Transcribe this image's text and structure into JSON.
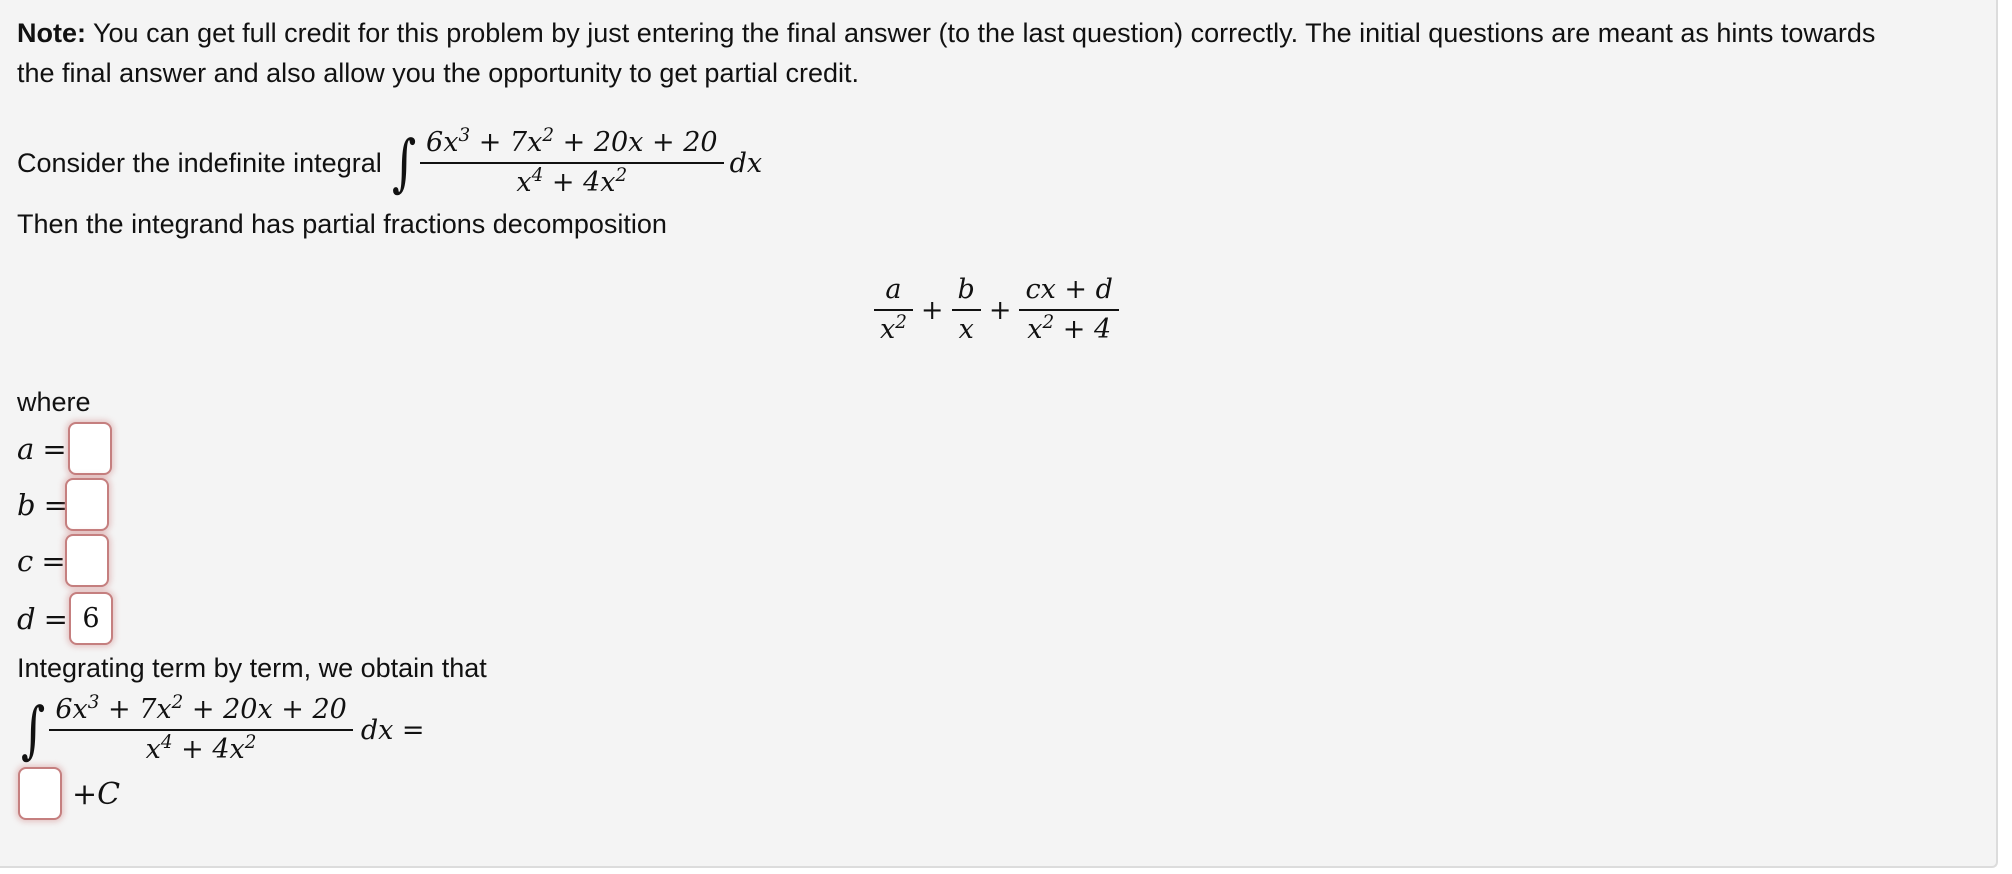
{
  "note": {
    "bold_label": "Note:",
    "line1": " You can get full credit for this problem by just entering the final answer (to the last question) correctly. The initial questions are meant as hints towards",
    "line2": "the final answer and also allow you the opportunity to get partial credit."
  },
  "intro": {
    "consider_text": "Consider the indefinite integral",
    "integral_symbol": "∫",
    "numerator": {
      "t1": "6x",
      "e1": "3",
      "p1": " + 7x",
      "e2": "2",
      "rest": " + 20x + 20"
    },
    "denominator": {
      "t1": "x",
      "e1": "4",
      "p1": " + 4x",
      "e2": "2"
    },
    "differential": "dx",
    "then_text": "Then the integrand has partial fractions decomposition"
  },
  "decomposition": {
    "term1": {
      "num": "a",
      "den": "x",
      "den_exp": "2"
    },
    "plus": "+",
    "term2": {
      "num": "b",
      "den": "x"
    },
    "term3": {
      "num": "cx + d",
      "den": "x",
      "den_exp": "2",
      "den_rest": " + 4"
    }
  },
  "where_text": "where",
  "fields": [
    {
      "var": "a",
      "eq": "=",
      "value": ""
    },
    {
      "var": "b",
      "eq": "=",
      "value": ""
    },
    {
      "var": "c",
      "eq": "=",
      "value": ""
    },
    {
      "var": "d",
      "eq": "=",
      "value": "6"
    }
  ],
  "integrating": {
    "text": "Integrating term by term, we obtain that",
    "differential_eq": "dx =",
    "answer_value": "",
    "constant": "+C"
  },
  "colors": {
    "panel_bg": "#f4f4f4",
    "input_border": "#c57f7f",
    "text": "#111111"
  }
}
